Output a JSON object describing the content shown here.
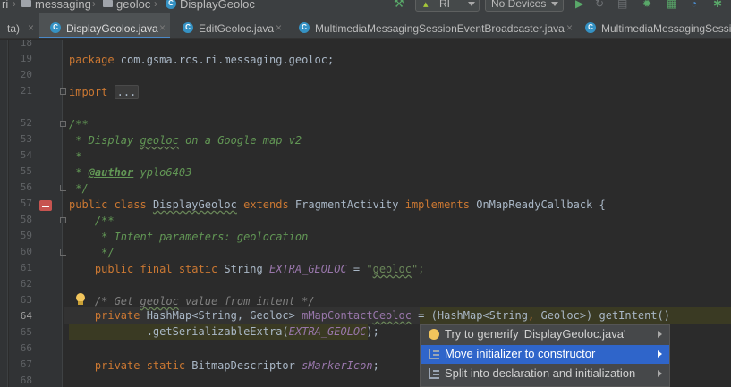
{
  "breadcrumb": {
    "items": [
      "ri",
      "messaging",
      "geoloc",
      "DisplayGeoloc"
    ]
  },
  "toolbar": {
    "run_config": "RI",
    "device": "No Devices",
    "icons": [
      "build-hammer-icon",
      "android-icon",
      "run-icon",
      "rerun-icon",
      "coverage-icon",
      "debug-icon",
      "profile-icon",
      "apply-changes-icon",
      "attach-debugger-icon"
    ]
  },
  "tabs": [
    {
      "label": "ta)",
      "close": "×",
      "active": false
    },
    {
      "label": "DisplayGeoloc.java",
      "close": "×",
      "active": true
    },
    {
      "label": "EditGeoloc.java",
      "close": "×",
      "active": false
    },
    {
      "label": "MultimediaMessagingSessionEventBroadcaster.java",
      "close": "×",
      "active": false
    },
    {
      "label": "MultimediaMessagingSessi",
      "close": "",
      "active": false
    }
  ],
  "editor": {
    "current_line": "64",
    "line_numbers": [
      "18",
      "19",
      "20",
      "21",
      "52",
      "53",
      "54",
      "55",
      "56",
      "57",
      "58",
      "59",
      "60",
      "61",
      "62",
      "63",
      "64",
      "65",
      "66",
      "67",
      "68"
    ],
    "code": {
      "package_kw": "package",
      "package_name": " com.gsma.rcs.ri.messaging.geoloc;",
      "import_kw": "import",
      "import_folded": "...",
      "l52": "/**",
      "l53_a": " * Display ",
      "l53_b": "geoloc",
      "l53_c": " on a Google map v2",
      "l54": " *",
      "l55_a": " * ",
      "l55_tag": "@author",
      "l55_b": " yplo6403",
      "l56": " */",
      "l57_kw1": "public class",
      "l57_name": "DisplayGeoloc",
      "l57_kw2": "extends",
      "l57_parent": "FragmentActivity",
      "l57_kw3": "implements",
      "l57_iface": "OnMapReadyCallback {",
      "l58": "    /**",
      "l59": "     * Intent parameters: geolocation",
      "l60": "     */",
      "l61_kw": "    public final static",
      "l61_type": " String ",
      "l61_field": "EXTRA_GEOLOC",
      "l61_eq": " = ",
      "l61_str_a": "\"",
      "l61_str_b": "geoloc",
      "l61_str_c": "\";",
      "l63_a": "    /* Get ",
      "l63_b": "geoloc",
      "l63_c": " value from intent */",
      "l64_kw": "    private",
      "l64_type": " HashMap<String, Geoloc> ",
      "l64_field_a": "mMapContact",
      "l64_field_b": "Geoloc",
      "l64_rest_a": " = ",
      "l64_rest_b": "(HashMap<String",
      "l64_rest_c": ", ",
      "l64_rest_d": "Geoloc>",
      "l64_rest_e": ") getIntent()",
      "l65_a": "            .getSerializableExtra(",
      "l65_field": "EXTRA_GEOLOC",
      "l65_b": ");",
      "l67_kw": "    private static",
      "l67_type": " BitmapDescriptor ",
      "l67_field": "sMarkerIcon",
      "l67_end": ";"
    }
  },
  "intention_popup": {
    "items": [
      {
        "label": "Try to generify 'DisplayGeoloc.java'",
        "icon": "lightbulb-icon",
        "selected": false
      },
      {
        "label": "Move initializer to constructor",
        "icon": "edit-intention-icon",
        "selected": true
      },
      {
        "label": "Split into declaration and initialization",
        "icon": "edit-intention-icon",
        "selected": false
      }
    ]
  },
  "colors": {
    "accent": "#2f65ca",
    "keyword": "#cc7832",
    "string": "#6a8759",
    "field": "#9876aa",
    "doc_comment": "#629755"
  }
}
